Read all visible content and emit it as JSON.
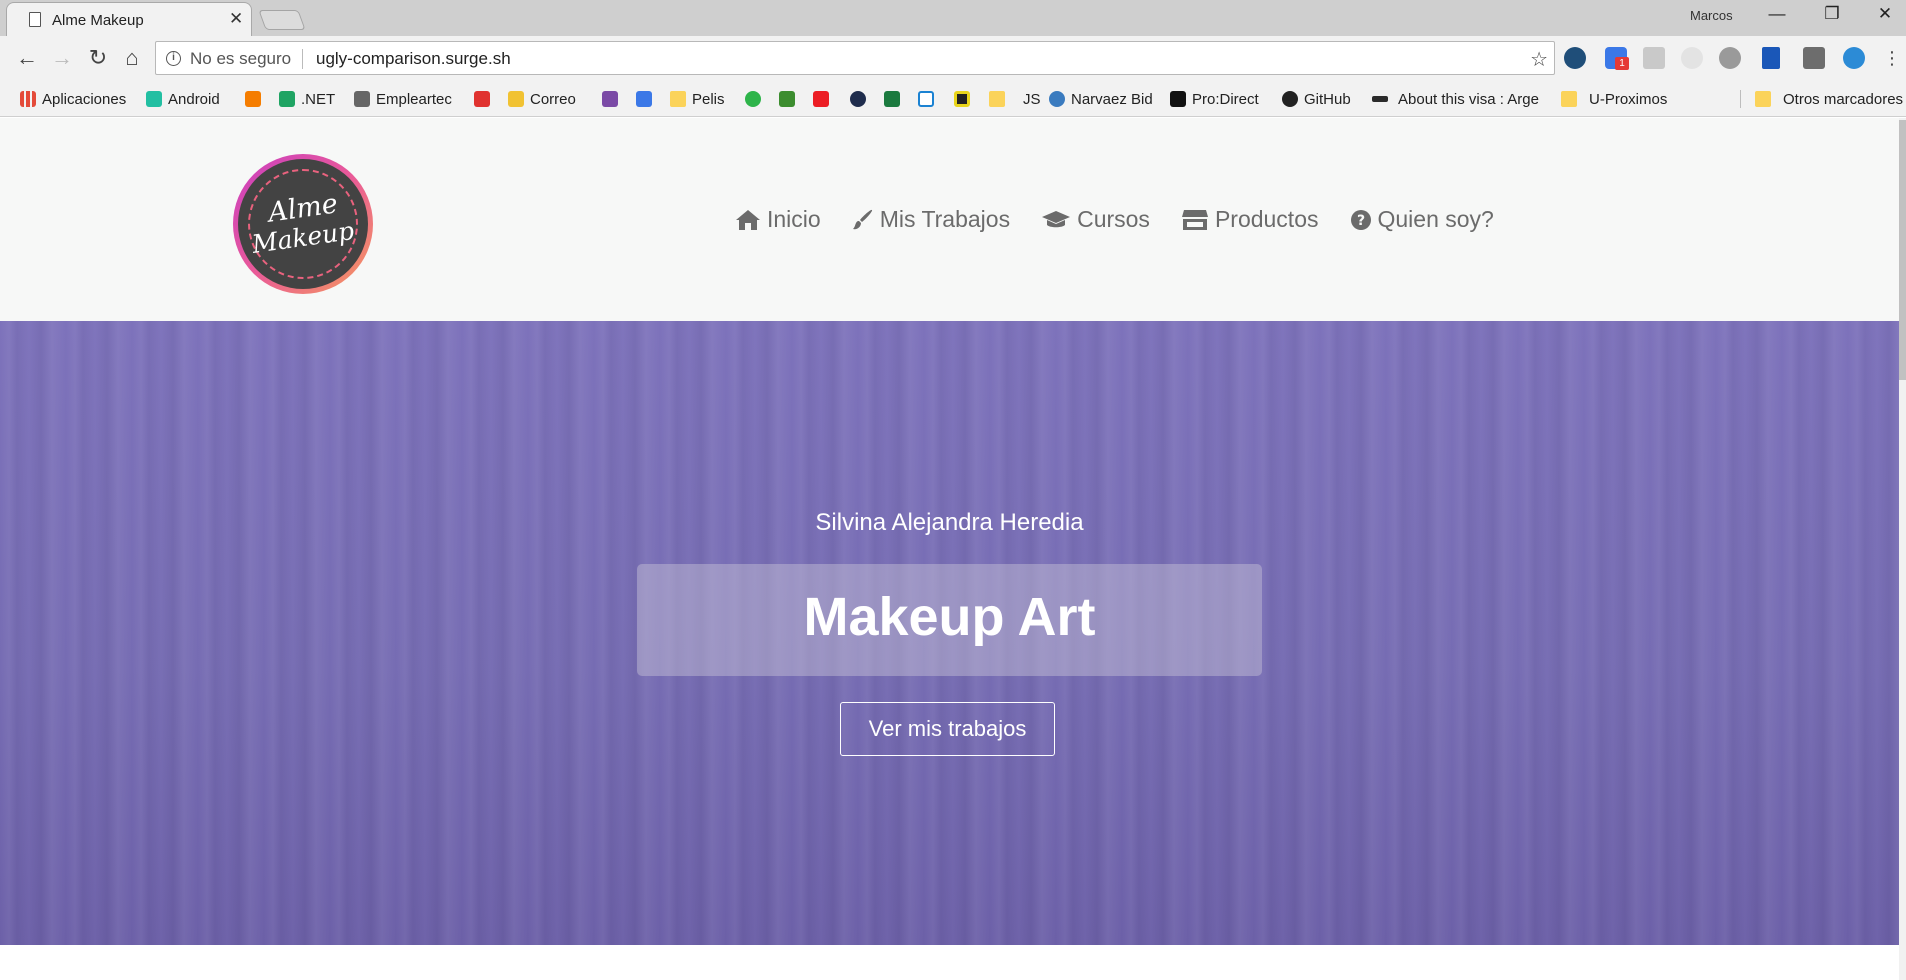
{
  "browser": {
    "tab_title": "Alme Makeup",
    "tab_close": "✕",
    "profile": "Marcos",
    "window_buttons": {
      "minimize": "—",
      "restore": "❐",
      "close": "✕"
    },
    "nav": {
      "back": "←",
      "forward": "→",
      "reload": "↻",
      "home": "⌂"
    },
    "security_label": "No es seguro",
    "url": "ugly-comparison.surge.sh",
    "star": "☆",
    "extension_badge": "1",
    "bookmarks": [
      {
        "label": "Aplicaciones",
        "icon": "apps-grid-icon",
        "color": "#e44b3a"
      },
      {
        "label": "Android",
        "icon": "android-icon",
        "color": "#22bfa2"
      },
      {
        "label": "",
        "icon": "blogger-icon",
        "color": "#f57d00"
      },
      {
        "label": ".NET",
        "icon": "drive-icon",
        "color": "#1fa463"
      },
      {
        "label": "Empleartec",
        "icon": "building-icon",
        "color": "#666666"
      },
      {
        "label": "",
        "icon": "u-logo-icon",
        "color": "#e0322f"
      },
      {
        "label": "Correo",
        "icon": "correo-icon",
        "color": "#f1c232"
      },
      {
        "label": "",
        "icon": "bag-icon",
        "color": "#7b4aa6"
      },
      {
        "label": "",
        "icon": "mail-icon",
        "color": "#3b78e7"
      },
      {
        "label": "Pelis",
        "icon": "folder-icon",
        "color": "#fbd35a"
      },
      {
        "label": "",
        "icon": "three-icon",
        "color": "#2eb44a"
      },
      {
        "label": "",
        "icon": "refresh-green-icon",
        "color": "#3c8d2f"
      },
      {
        "label": "",
        "icon": "santander-icon",
        "color": "#ec1d24"
      },
      {
        "label": "",
        "icon": "e-circle-icon",
        "color": "#1f2d4d"
      },
      {
        "label": "",
        "icon": "twenty-one-icon",
        "color": "#1b7a3f"
      },
      {
        "label": "",
        "icon": "windows-icon",
        "color": "#1b82d2"
      },
      {
        "label": "",
        "icon": "yellow-circle-icon",
        "color": "#222222"
      },
      {
        "label": "JS",
        "icon": "folder-icon",
        "color": "#fbd35a"
      },
      {
        "label": "Narvaez Bid",
        "icon": "narvaez-icon",
        "color": "#3a7bbf"
      },
      {
        "label": "Pro:Direct",
        "icon": "prodirect-icon",
        "color": "#111111"
      },
      {
        "label": "GitHub",
        "icon": "github-icon",
        "color": "#222222"
      },
      {
        "label": "About this visa : Arge",
        "icon": "fern-icon",
        "color": "#2b2b2b"
      },
      {
        "label": "U-Proximos",
        "icon": "folder-icon",
        "color": "#fbd35a"
      }
    ],
    "other_bookmarks": "Otros marcadores"
  },
  "site": {
    "logo_line1": "Alme",
    "logo_line2": "Makeup",
    "menu": [
      {
        "label": "Inicio",
        "icon": "home-icon"
      },
      {
        "label": "Mis Trabajos",
        "icon": "brush-icon"
      },
      {
        "label": "Cursos",
        "icon": "graduation-cap-icon"
      },
      {
        "label": "Productos",
        "icon": "store-icon"
      },
      {
        "label": "Quien soy?",
        "icon": "question-circle-icon"
      }
    ],
    "hero": {
      "subtitle": "Silvina Alejandra Heredia",
      "title": "Makeup Art",
      "button": "Ver mis trabajos"
    }
  },
  "colors": {
    "hero_purple": "#766cb3",
    "header_bg": "#f7f8f7",
    "menu_text": "#6b6b6b"
  }
}
